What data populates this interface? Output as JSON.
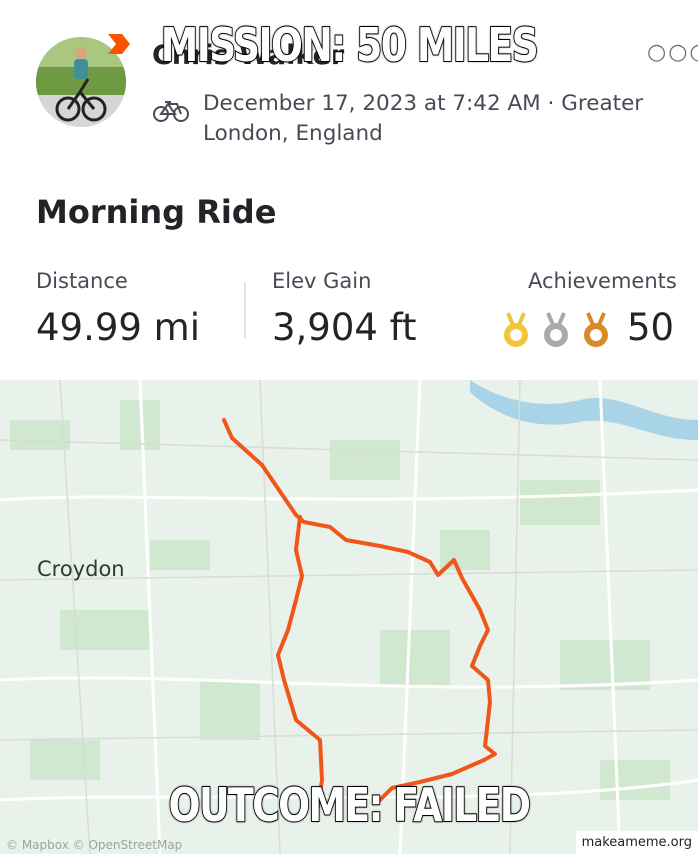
{
  "activity": {
    "athlete_name": "Chris Walker",
    "datetime_location": "December 17, 2023 at 7:42 AM · Greater London, England",
    "more_icon": "more-horizontal-icon",
    "sport_icon": "bike-icon",
    "title": "Morning Ride"
  },
  "stats": {
    "distance_label": "Distance",
    "distance_value": "49.99 mi",
    "elev_label": "Elev Gain",
    "elev_value": "3,904 ft",
    "achievements_label": "Achievements",
    "achievements_value": "50",
    "medal_colors": [
      "#f2c43a",
      "#a8a8ad",
      "#d68a2a"
    ]
  },
  "map": {
    "place_label": "Croydon",
    "attribution": "© Mapbox © OpenStreetMap",
    "route_color": "#f0561a"
  },
  "meme": {
    "top_text": "MISSION: 50 MILES",
    "bottom_text": "OUTCOME: FAILED",
    "watermark": "makeameme.org"
  }
}
